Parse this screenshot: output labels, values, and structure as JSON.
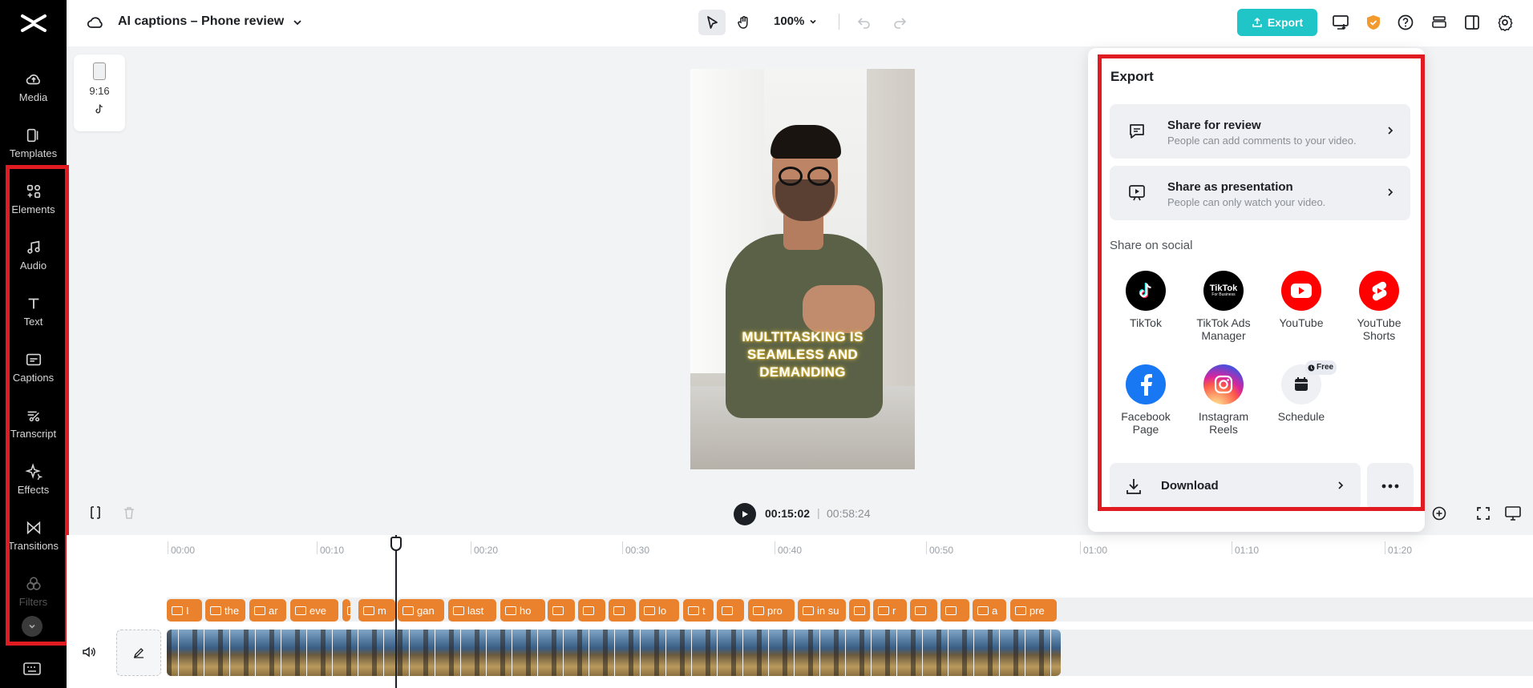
{
  "project": {
    "title": "AI captions – Phone review"
  },
  "toolbar": {
    "zoom": "100%",
    "export_label": "Export"
  },
  "sidebar": {
    "items": [
      {
        "label": "Media",
        "icon": "cloud-upload-icon"
      },
      {
        "label": "Templates",
        "icon": "templates-icon"
      },
      {
        "label": "Elements",
        "icon": "elements-icon"
      },
      {
        "label": "Audio",
        "icon": "music-note-icon"
      },
      {
        "label": "Text",
        "icon": "text-t-icon"
      },
      {
        "label": "Captions",
        "icon": "captions-icon"
      },
      {
        "label": "Transcript",
        "icon": "transcript-icon"
      },
      {
        "label": "Effects",
        "icon": "sparkle-icon"
      },
      {
        "label": "Transitions",
        "icon": "transitions-icon"
      },
      {
        "label": "Filters",
        "icon": "filters-icon"
      }
    ]
  },
  "canvas": {
    "aspect_ratio": "9:16",
    "caption_text": "MULTITASKING IS SEAMLESS AND DEMANDING"
  },
  "player": {
    "current_time": "00:15:02",
    "separator": "|",
    "total_time": "00:58:24"
  },
  "timeline": {
    "ticks": [
      "00:00",
      "00:10",
      "00:20",
      "00:30",
      "00:40",
      "00:50",
      "01:00",
      "01:10",
      "01:20"
    ],
    "caption_clips": [
      "I",
      "the",
      "ar",
      "eve",
      "[",
      "m",
      "gan",
      "last",
      "ho",
      "",
      "",
      "",
      "lo",
      "t",
      "",
      "pro",
      "in su",
      "",
      "r",
      "",
      "",
      "a",
      "pre"
    ]
  },
  "export_panel": {
    "title": "Export",
    "share_review": {
      "title": "Share for review",
      "subtitle": "People can add comments to your video."
    },
    "share_presentation": {
      "title": "Share as presentation",
      "subtitle": "People can only watch your video."
    },
    "social_heading": "Share on social",
    "socials": [
      {
        "label": "TikTok",
        "icon": "tiktok-icon",
        "color": "#000000"
      },
      {
        "label": "TikTok Ads Manager",
        "icon": "tiktok-business-icon",
        "color": "#000000"
      },
      {
        "label": "YouTube",
        "icon": "youtube-icon",
        "color": "#ff0000"
      },
      {
        "label": "YouTube Shorts",
        "icon": "youtube-shorts-icon",
        "color": "#ff0000"
      },
      {
        "label": "Facebook Page",
        "icon": "facebook-icon",
        "color": "#1877f2"
      },
      {
        "label": "Instagram Reels",
        "icon": "instagram-icon",
        "color": "#d62976"
      },
      {
        "label": "Schedule",
        "icon": "calendar-icon",
        "color": "#eef0f3"
      }
    ],
    "free_badge": "Free",
    "tiktok_ads_logo": "TikTok",
    "tiktok_ads_logo_sub": "For Business",
    "download_label": "Download"
  },
  "colors": {
    "accent": "#20c5c8",
    "caption_clip": "#e9812d",
    "highlight": "#e11b22"
  }
}
